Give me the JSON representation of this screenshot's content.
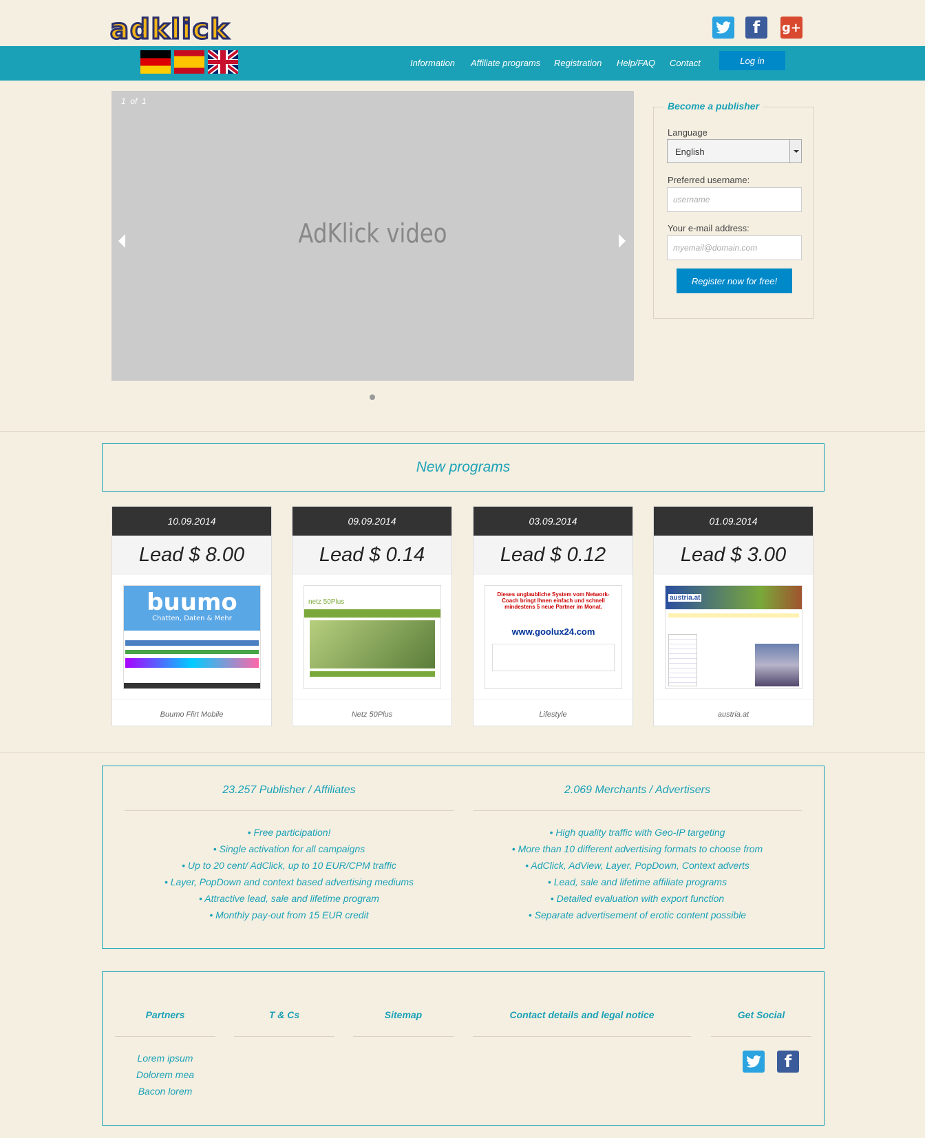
{
  "header": {
    "logo_text": "adklick",
    "social": [
      "twitter-icon",
      "facebook-icon",
      "google-plus-icon"
    ]
  },
  "nav": {
    "flags": [
      "german-flag",
      "spanish-flag",
      "uk-flag"
    ],
    "items": [
      "Information",
      "Affiliate programs",
      "Registration",
      "Help/FAQ",
      "Contact"
    ],
    "login": "Log in"
  },
  "slider": {
    "counter_current": "1",
    "counter_of": "of",
    "counter_total": "1",
    "title": "AdKlick video"
  },
  "publisher": {
    "heading": "Become a publisher",
    "language_label": "Language",
    "language_value": "English",
    "username_label": "Preferred username:",
    "username_placeholder": "username",
    "email_label": "Your e-mail address:",
    "email_placeholder": "myemail@domain.com",
    "register_button": "Register now for free!"
  },
  "new_programs": {
    "heading": "New programs",
    "cards": [
      {
        "date": "10.09.2014",
        "price": "Lead $ 8.00",
        "name": "Buumo Flirt Mobile",
        "thumb_title": "buumo",
        "thumb_sub": "Chatten, Daten & Mehr"
      },
      {
        "date": "09.09.2014",
        "price": "Lead $ 0.14",
        "name": "Netz 50Plus",
        "thumb_title": "netz 50Plus"
      },
      {
        "date": "03.09.2014",
        "price": "Lead $ 0.12",
        "name": "Lifestyle",
        "thumb_title": "Dieses unglaubliche System vom Network-Coach bringt Ihnen einfach und schnell mindestens 5 neue Partner im Monat.",
        "thumb_url": "www.goolux24.com"
      },
      {
        "date": "01.09.2014",
        "price": "Lead $ 3.00",
        "name": "austria.at",
        "thumb_title": "austria.at"
      }
    ]
  },
  "stats": {
    "publishers": {
      "title": "23.257 Publisher / Affiliates",
      "items": [
        "Free participation!",
        "Single activation for all campaigns",
        "Up to 20 cent/ AdClick, up to 10 EUR/CPM traffic",
        "Layer, PopDown and context based advertising mediums",
        "Attractive lead, sale and lifetime program",
        "Monthly pay-out from 15 EUR credit"
      ]
    },
    "merchants": {
      "title": "2.069 Merchants / Advertisers",
      "items": [
        "High quality traffic with Geo-IP targeting",
        "More than 10 different advertising formats to choose from",
        "AdClick, AdView, Layer, PopDown, Context adverts",
        "Lead, sale and lifetime affiliate programs",
        "Detailed evaluation with export function",
        "Separate advertisement of erotic content possible"
      ]
    }
  },
  "footer": {
    "partners": {
      "title": "Partners",
      "links": [
        "Lorem ipsum",
        "Dolorem mea",
        "Bacon lorem"
      ]
    },
    "terms": {
      "title": "T & Cs"
    },
    "sitemap": {
      "title": "Sitemap"
    },
    "contact": {
      "title": "Contact details and legal notice"
    },
    "social": {
      "title": "Get Social",
      "icons": [
        "twitter-icon",
        "facebook-icon"
      ]
    }
  },
  "colors": {
    "background": "#f4efe1",
    "accent": "#1ba1b7",
    "button": "#0089c9",
    "card_header": "#333333"
  }
}
